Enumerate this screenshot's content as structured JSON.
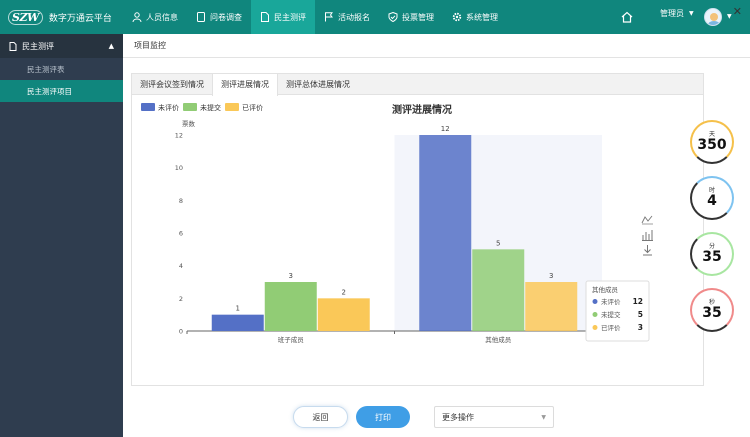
{
  "app": {
    "logo_text": "SZW",
    "title": "数字万通云平台"
  },
  "nav": [
    {
      "label": "人员信息",
      "icon": "user-icon",
      "active": false
    },
    {
      "label": "问卷调查",
      "icon": "tablet-icon",
      "active": false
    },
    {
      "label": "民主测评",
      "icon": "document-icon",
      "active": true
    },
    {
      "label": "活动报名",
      "icon": "flag-icon",
      "active": false
    },
    {
      "label": "投票管理",
      "icon": "shield-icon",
      "active": false
    },
    {
      "label": "系统管理",
      "icon": "gear-icon",
      "active": false
    }
  ],
  "user": {
    "role": "管理员"
  },
  "sidebar": {
    "group": "民主测评",
    "items": [
      {
        "label": "民主测评表",
        "active": false
      },
      {
        "label": "民主测评项目",
        "active": true
      }
    ]
  },
  "breadcrumb": "项目监控",
  "tabs": [
    {
      "label": "测评会议签到情况",
      "active": false
    },
    {
      "label": "测评进展情况",
      "active": true
    },
    {
      "label": "测评总体进展情况",
      "active": false
    }
  ],
  "chart_data": {
    "type": "bar",
    "title": "测评进展情况",
    "ylabel": "票数",
    "xlabel": "",
    "categories": [
      "班子成员",
      "其他成员"
    ],
    "series": [
      {
        "name": "未评价",
        "color": "#5470c6",
        "values": [
          1,
          12
        ]
      },
      {
        "name": "未提交",
        "color": "#91cc75",
        "values": [
          3,
          5
        ]
      },
      {
        "name": "已评价",
        "color": "#fac858",
        "values": [
          2,
          3
        ]
      }
    ],
    "ylim": [
      0,
      12
    ],
    "yticks": [
      0,
      2,
      4,
      6,
      8,
      10,
      12
    ],
    "grid": false,
    "legend": "top-left",
    "highlighted_category": "其他成员",
    "tooltip": {
      "title": "其他成员",
      "rows": [
        {
          "name": "未评价",
          "value": "12"
        },
        {
          "name": "未提交",
          "value": "5"
        },
        {
          "name": "已评价",
          "value": "3"
        }
      ]
    }
  },
  "timers": [
    {
      "label": "天",
      "value": "350",
      "color": "#f5c04a"
    },
    {
      "label": "时",
      "value": "4",
      "color": "#7ec3f0"
    },
    {
      "label": "分",
      "value": "35",
      "color": "#a8e6a1"
    },
    {
      "label": "秒",
      "value": "35",
      "color": "#f08a8a"
    }
  ],
  "buttons": {
    "back": "返回",
    "print": "打印"
  },
  "more_select": {
    "value": "更多操作"
  }
}
